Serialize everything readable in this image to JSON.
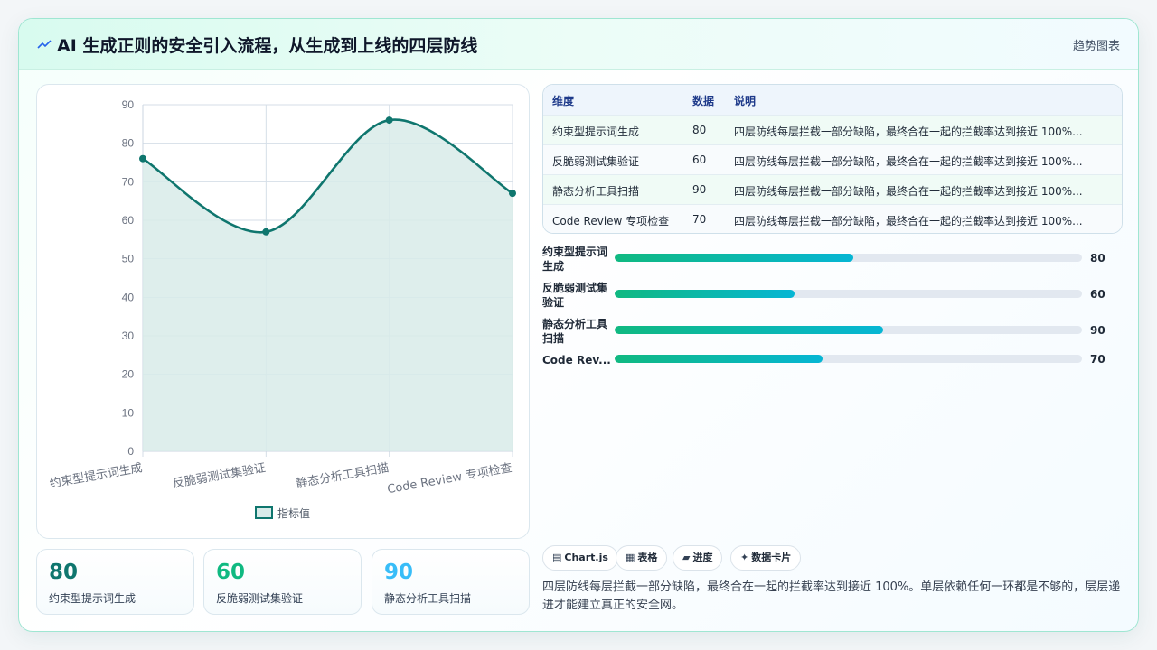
{
  "header": {
    "title": "AI 生成正则的安全引入流程，从生成到上线的四层防线",
    "tag": "趋势图表"
  },
  "chart_data": {
    "type": "line",
    "categories": [
      "约束型提示词生成",
      "反脆弱测试集验证",
      "静态分析工具扫描",
      "Code Review 专项检查"
    ],
    "series": [
      {
        "name": "指标值",
        "values": [
          76,
          57,
          86,
          67
        ]
      }
    ],
    "ylim": [
      0,
      90
    ],
    "yticks": [
      0,
      10,
      20,
      30,
      40,
      50,
      60,
      70,
      80,
      90
    ],
    "grid": true,
    "legend": "bottom",
    "colors": {
      "line": "#0f766e",
      "fill": "#d8ebe9"
    }
  },
  "kpis": [
    {
      "value": "80",
      "label": "约束型提示词生成",
      "color": "#0f766e"
    },
    {
      "value": "60",
      "label": "反脆弱测试集验证",
      "color": "#10b981"
    },
    {
      "value": "90",
      "label": "静态分析工具扫描",
      "color": "#38bdf8"
    }
  ],
  "table": {
    "headers": [
      "维度",
      "数据",
      "说明"
    ],
    "rows": [
      {
        "name": "约束型提示词生成",
        "value": "80",
        "note": "四层防线每层拦截一部分缺陷，最终合在一起的拦截率达到接近 100%..."
      },
      {
        "name": "反脆弱测试集验证",
        "value": "60",
        "note": "四层防线每层拦截一部分缺陷，最终合在一起的拦截率达到接近 100%..."
      },
      {
        "name": "静态分析工具扫描",
        "value": "90",
        "note": "四层防线每层拦截一部分缺陷，最终合在一起的拦截率达到接近 100%..."
      },
      {
        "name": "Code Review 专项检查",
        "value": "70",
        "note": "四层防线每层拦截一部分缺陷，最终合在一起的拦截率达到接近 100%..."
      }
    ]
  },
  "bars": [
    {
      "label": "约束型提示词生成",
      "value": "80",
      "fraction": 0.51
    },
    {
      "label": "反脆弱测试集验证",
      "value": "60",
      "fraction": 0.385
    },
    {
      "label": "静态分析工具扫描",
      "value": "90",
      "fraction": 0.575
    },
    {
      "label": "Code Rev...",
      "value": "70",
      "fraction": 0.445
    }
  ],
  "chips": [
    {
      "icon": "▤",
      "label": "Chart.js"
    },
    {
      "icon": "▦",
      "label": "表格"
    },
    {
      "icon": "▰",
      "label": "进度"
    },
    {
      "icon": "✦",
      "label": "数据卡片"
    }
  ],
  "description": "四层防线每层拦截一部分缺陷，最终合在一起的拦截率达到接近 100%。单层依赖任何一环都是不够的，层层递进才能建立真正的安全网。"
}
